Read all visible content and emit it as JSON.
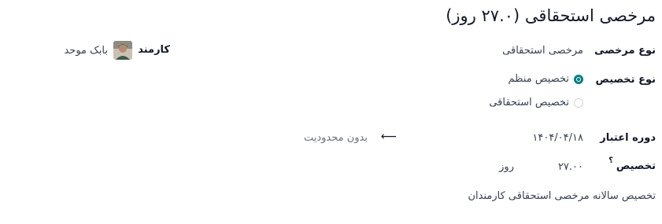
{
  "form": {
    "title": "مرخصی استحقاقی (۲۷.۰ روز)"
  },
  "leave_type": {
    "label": "نوع مرخصی",
    "value": "مرخصی استحقاقی"
  },
  "employee": {
    "label": "کارمند",
    "name": "بابک موحد"
  },
  "allocation_type": {
    "label": "نوع تخصیص",
    "options": [
      {
        "label": "تخصیص منظم",
        "checked": true
      },
      {
        "label": "تخصیص استحقاقی",
        "checked": false
      }
    ]
  },
  "validity_period": {
    "label": "دوره اعتبار",
    "start": "۱۴۰۴/۰۴/۱۸",
    "end_placeholder": "بدون محدودیت"
  },
  "allocation": {
    "label": "تخصیص",
    "help_mark": "؟",
    "value": "۲۷.۰۰",
    "unit": "روز"
  },
  "description": "تخصیص سالانه مرخصی استحقاقی کارمندان",
  "colors": {
    "accent": "#017e84"
  }
}
